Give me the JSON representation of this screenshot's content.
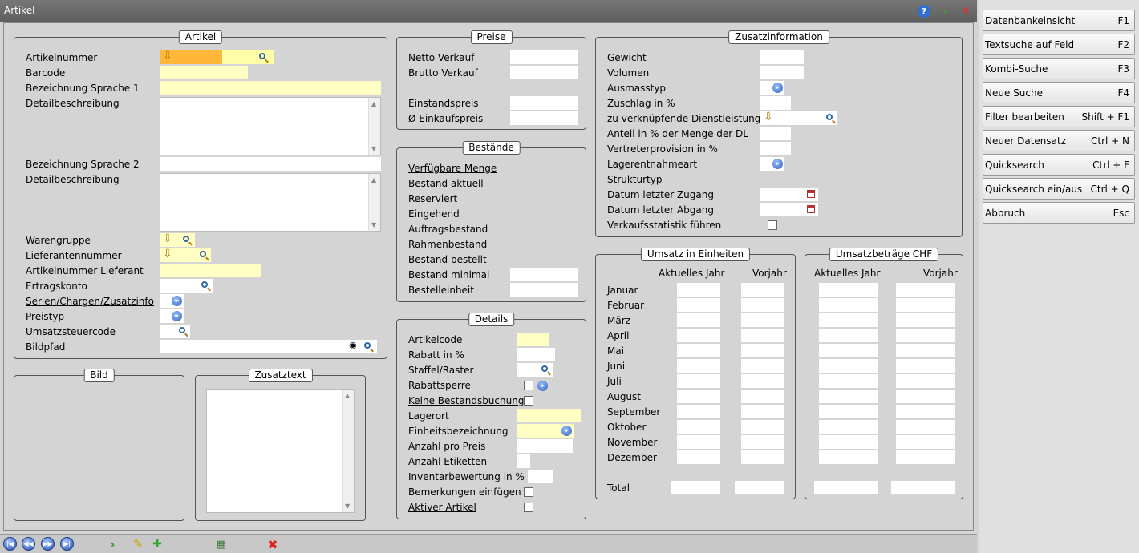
{
  "window": {
    "title": "Artikel"
  },
  "artikel": {
    "title": "Artikel",
    "labels": {
      "artikelnummer": "Artikelnummer",
      "barcode": "Barcode",
      "bez1": "Bezeichnung Sprache 1",
      "detail1": "Detailbeschreibung",
      "bez2": "Bezeichnung Sprache 2",
      "detail2": "Detailbeschreibung",
      "warengruppe": "Warengruppe",
      "lieferant": "Lieferantennummer",
      "artnrlief": "Artikelnummer Lieferant",
      "ertrag": "Ertragskonto",
      "serien": "Serien/Chargen/Zusatzinfo",
      "preistyp": "Preistyp",
      "ust": "Umsatzsteuercode",
      "bild": "Bildpfad"
    }
  },
  "bild": {
    "title": "Bild"
  },
  "zusatztext": {
    "title": "Zusatztext"
  },
  "preise": {
    "title": "Preise",
    "labels": {
      "netto": "Netto Verkauf",
      "brutto": "Brutto Verkauf",
      "einstand": "Einstandspreis",
      "einkauf": "Ø Einkaufspreis"
    }
  },
  "bestaende": {
    "title": "Bestände",
    "labels": {
      "verfuegbar": "Verfügbare Menge",
      "aktuell": "Bestand aktuell",
      "reserviert": "Reserviert",
      "eingehend": "Eingehend",
      "auftrag": "Auftragsbestand",
      "rahmen": "Rahmenbestand",
      "bestellt": "Bestand bestellt",
      "minimal": "Bestand minimal",
      "einheit": "Bestelleinheit"
    }
  },
  "details": {
    "title": "Details",
    "labels": {
      "artikelcode": "Artikelcode",
      "rabatt": "Rabatt in %",
      "staffel": "Staffel/Raster",
      "rabattsperre": "Rabattsperre",
      "keine": "Keine Bestandsbuchung",
      "lagerort": "Lagerort",
      "einheitsbez": "Einheitsbezeichnung",
      "anzahlpreis": "Anzahl pro Preis",
      "etiketten": "Anzahl Etiketten",
      "inventar": "Inventarbewertung in %",
      "bemerkungen": "Bemerkungen einfügen",
      "aktiv": "Aktiver Artikel"
    }
  },
  "zusatzinfo": {
    "title": "Zusatzinformation",
    "labels": {
      "gewicht": "Gewicht",
      "volumen": "Volumen",
      "ausmass": "Ausmasstyp",
      "zuschlag": "Zuschlag in %",
      "dienst": "zu verknüpfende Dienstleistung",
      "anteil": "Anteil in % der Menge der DL",
      "vertreter": "Vertreterprovision in %",
      "lagerentnahme": "Lagerentnahmeart",
      "struktur": "Strukturtyp",
      "zugang": "Datum letzter Zugang",
      "abgang": "Datum letzter Abgang",
      "statistik": "Verkaufsstatistik führen"
    }
  },
  "umsatz_einheiten": {
    "title": "Umsatz in Einheiten",
    "col1": "Aktuelles Jahr",
    "col2": "Vorjahr"
  },
  "umsatz_chf": {
    "title": "Umsatzbeträge CHF",
    "col1": "Aktuelles Jahr",
    "col2": "Vorjahr"
  },
  "months": [
    "Januar",
    "Februar",
    "März",
    "April",
    "Mai",
    "Juni",
    "Juli",
    "August",
    "September",
    "Oktober",
    "November",
    "Dezember"
  ],
  "total_label": "Total",
  "shortcuts": [
    {
      "label": "Datenbankeinsicht",
      "key": "F1"
    },
    {
      "label": "Textsuche auf Feld",
      "key": "F2"
    },
    {
      "label": "Kombi-Suche",
      "key": "F3"
    },
    {
      "label": "Neue Suche",
      "key": "F4"
    },
    {
      "label": "Filter bearbeiten",
      "key": "Shift + F1"
    },
    {
      "label": "Neuer Datensatz",
      "key": "Ctrl + N"
    },
    {
      "label": "Quicksearch",
      "key": "Ctrl + F"
    },
    {
      "label": "Quicksearch ein/aus",
      "key": "Ctrl + Q"
    },
    {
      "label": "Abbruch",
      "key": "Esc"
    }
  ],
  "icons": {
    "help": "help-icon",
    "next": "go-icon",
    "close": "close-icon"
  },
  "colors": {
    "required": "#ffffc4",
    "focus": "#ffb73a",
    "titlebar": "#666666"
  }
}
